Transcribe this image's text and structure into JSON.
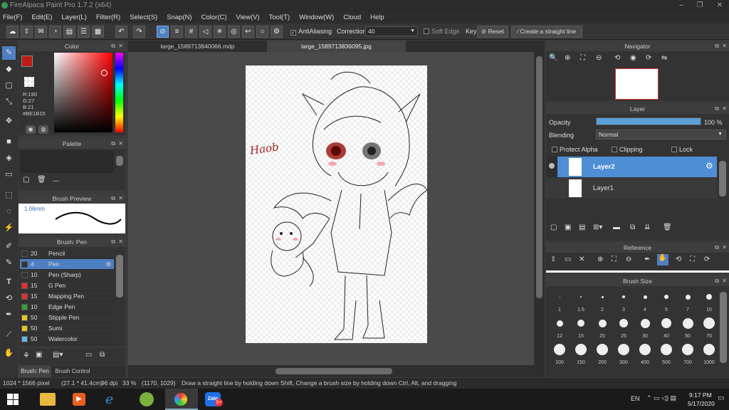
{
  "window": {
    "title": "FireAlpaca Paint Pro 1.7.2 (x64)",
    "controls": [
      "–",
      "❐",
      "✕"
    ]
  },
  "menu": [
    "File(F)",
    "Edit(E)",
    "Layer(L)",
    "Filter(R)",
    "Select(S)",
    "Snap(N)",
    "Color(C)",
    "View(V)",
    "Tool(T)",
    "Window(W)",
    "Cloud",
    "Help"
  ],
  "toolbar": {
    "antialiasing": "AntiAliasing",
    "correction_label": "Correction",
    "correction_value": "40",
    "soft_edge": "Soft Edge",
    "key": "Key",
    "reset": "Reset",
    "straight_line": "Create a straight line"
  },
  "color_panel": {
    "title": "Color",
    "r": "R:190",
    "g": "G:27",
    "b": "B:21",
    "hex": "#BE1B15",
    "primary": "#be1b15"
  },
  "palette_panel": {
    "title": "Palette",
    "extra": "---"
  },
  "brush_preview": {
    "title": "Brush Preview",
    "size": "1.06mm"
  },
  "brush_panel": {
    "title": "Brush: Pen",
    "items": [
      {
        "size": "20",
        "name": "Pencil",
        "color": "#333333"
      },
      {
        "size": "4",
        "name": "Pen",
        "color": "#333333"
      },
      {
        "size": "10",
        "name": "Pen (Sharp)",
        "color": "#333333"
      },
      {
        "size": "15",
        "name": "G Pen",
        "color": "#e53030"
      },
      {
        "size": "15",
        "name": "Mapping Pen",
        "color": "#e53030"
      },
      {
        "size": "10",
        "name": "Edge Pen",
        "color": "#2fa52f"
      },
      {
        "size": "50",
        "name": "Stipple Pen",
        "color": "#e5c520"
      },
      {
        "size": "50",
        "name": "Sumi",
        "color": "#e5c520"
      },
      {
        "size": "50",
        "name": "Watercolor",
        "color": "#60b8e8"
      }
    ],
    "tabs": [
      "Brush: Pen",
      "Brush Control"
    ]
  },
  "doc_tabs": [
    "large_1589713840066.mdp",
    "large_1589713836095.jpg"
  ],
  "navigator": {
    "title": "Navigator"
  },
  "layer_panel": {
    "title": "Layer",
    "opacity_label": "Opacity",
    "opacity_value": "100 %",
    "opacity": 1.0,
    "blending_label": "Blending",
    "blending_value": "Normal",
    "protect_alpha": "Protect Alpha",
    "clipping": "Clipping",
    "lock": "Lock",
    "layers": [
      "Layer2",
      "Layer1"
    ]
  },
  "reference": {
    "title": "Reference"
  },
  "brush_size": {
    "title": "Brush Size",
    "sizes": [
      "1",
      "1.5",
      "2",
      "3",
      "4",
      "5",
      "7",
      "10",
      "12",
      "15",
      "20",
      "25",
      "30",
      "40",
      "50",
      "70",
      "100",
      "150",
      "200",
      "300",
      "400",
      "500",
      "700",
      "1000"
    ]
  },
  "status": {
    "dimensions": "1024 * 1566 pixel",
    "physical": "(27.1 * 41.4cm)",
    "dpi": "96 dpi",
    "zoom": "33 %",
    "coords": "(1170, 1029)",
    "hint": "Draw a straight line by holding down Shift, Change a brush size by holding down Ctrl, Alt, and dragging"
  },
  "taskbar": {
    "lang": "EN",
    "time": "9:17 PM",
    "date": "5/17/2020",
    "zalo": "Zalo",
    "zalo_badge": "5+"
  },
  "drawing": {
    "signature": "Haob"
  }
}
